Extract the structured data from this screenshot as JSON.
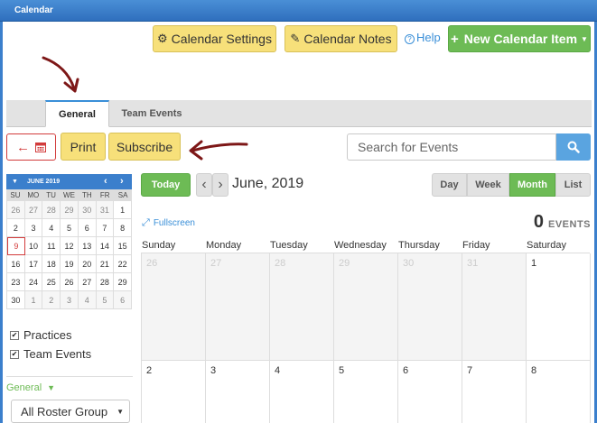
{
  "window": {
    "title": "Calendar"
  },
  "toolbar": {
    "settings_label": "Calendar Settings",
    "notes_label": "Calendar Notes",
    "help_label": "Help",
    "new_item_label": "New Calendar Item"
  },
  "tabs": [
    {
      "label": "General",
      "active": true
    },
    {
      "label": "Team Events",
      "active": false
    }
  ],
  "actions": {
    "print_label": "Print",
    "subscribe_label": "Subscribe"
  },
  "search": {
    "placeholder": "Search for Events"
  },
  "mini_calendar": {
    "month_label": "JUNE 2019",
    "dow": [
      "SU",
      "MO",
      "TU",
      "WE",
      "TH",
      "FR",
      "SA"
    ],
    "weeks": [
      [
        "26",
        "27",
        "28",
        "29",
        "30",
        "31",
        "1"
      ],
      [
        "2",
        "3",
        "4",
        "5",
        "6",
        "7",
        "8"
      ],
      [
        "9",
        "10",
        "11",
        "12",
        "13",
        "14",
        "15"
      ],
      [
        "16",
        "17",
        "18",
        "19",
        "20",
        "21",
        "22"
      ],
      [
        "23",
        "24",
        "25",
        "26",
        "27",
        "28",
        "29"
      ],
      [
        "30",
        "1",
        "2",
        "3",
        "4",
        "5",
        "6"
      ]
    ],
    "today": "9"
  },
  "filters": [
    {
      "label": "Practices",
      "checked": true
    },
    {
      "label": "Team Events",
      "checked": true
    }
  ],
  "sidebar": {
    "general_dropdown_label": "General",
    "roster_group_label": "All Roster Group"
  },
  "nav": {
    "today_label": "Today",
    "period_title": "June, 2019"
  },
  "views": [
    {
      "label": "Day",
      "active": false
    },
    {
      "label": "Week",
      "active": false
    },
    {
      "label": "Month",
      "active": true
    },
    {
      "label": "List",
      "active": false
    }
  ],
  "fullscreen_label": "Fullscreen",
  "events": {
    "count": "0",
    "label": "EVENTS"
  },
  "month_view": {
    "dow": [
      "Sunday",
      "Monday",
      "Tuesday",
      "Wednesday",
      "Thursday",
      "Friday",
      "Saturday"
    ],
    "weeks": [
      [
        "26",
        "27",
        "28",
        "29",
        "30",
        "31",
        "1"
      ],
      [
        "2",
        "3",
        "4",
        "5",
        "6",
        "7",
        "8"
      ]
    ]
  },
  "colors": {
    "accent_blue": "#3a8fd8",
    "green": "#6dbb55",
    "yellow": "#f7e07a",
    "red": "#d23b3b",
    "annotation_arrow": "#7d1717"
  }
}
